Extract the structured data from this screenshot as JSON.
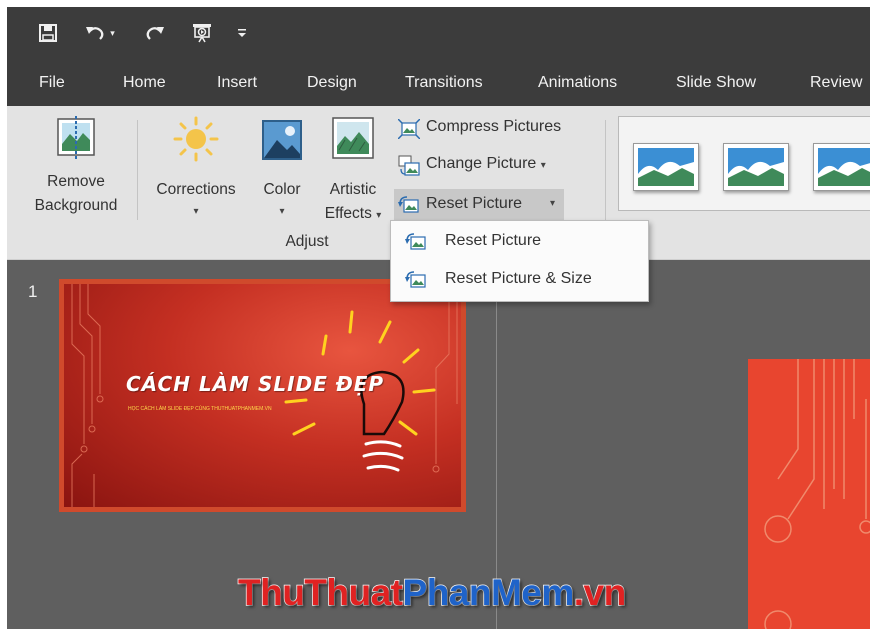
{
  "quick_access": {
    "save_icon": "save-icon",
    "undo_icon": "undo-icon",
    "redo_icon": "redo-icon",
    "presentation_icon": "start-from-beginning-icon",
    "customize_icon": "customize-toolbar-icon"
  },
  "tabs": [
    "File",
    "Home",
    "Insert",
    "Design",
    "Transitions",
    "Animations",
    "Slide Show",
    "Review"
  ],
  "ribbon": {
    "remove_background": {
      "line1": "Remove",
      "line2": "Background"
    },
    "corrections": "Corrections",
    "color": "Color",
    "artistic_effects": {
      "line1": "Artistic",
      "line2": "Effects"
    },
    "compress_pictures": "Compress Pictures",
    "change_picture": "Change Picture",
    "reset_picture": "Reset Picture",
    "group_adjust": "Adjust"
  },
  "dropdown": {
    "items": [
      "Reset Picture",
      "Reset Picture & Size"
    ]
  },
  "slides": {
    "number": "1",
    "title": "CÁCH LÀM SLIDE ĐẸP",
    "subtitle": "HỌC CÁCH LÀM SLIDE ĐẸP CÙNG THUTHUATPHANMEM.VN"
  },
  "watermark": {
    "part1": "ThuThuat",
    "part2": "PhanMem",
    "part3": ".vn"
  },
  "colors": {
    "titlebar": "#3c3c3c",
    "ribbon": "#e3e3e3",
    "workspace": "#5f5f5f",
    "slide_red": "#c42f22",
    "watermark_red": "#e02222",
    "watermark_blue": "#1f63c9"
  }
}
